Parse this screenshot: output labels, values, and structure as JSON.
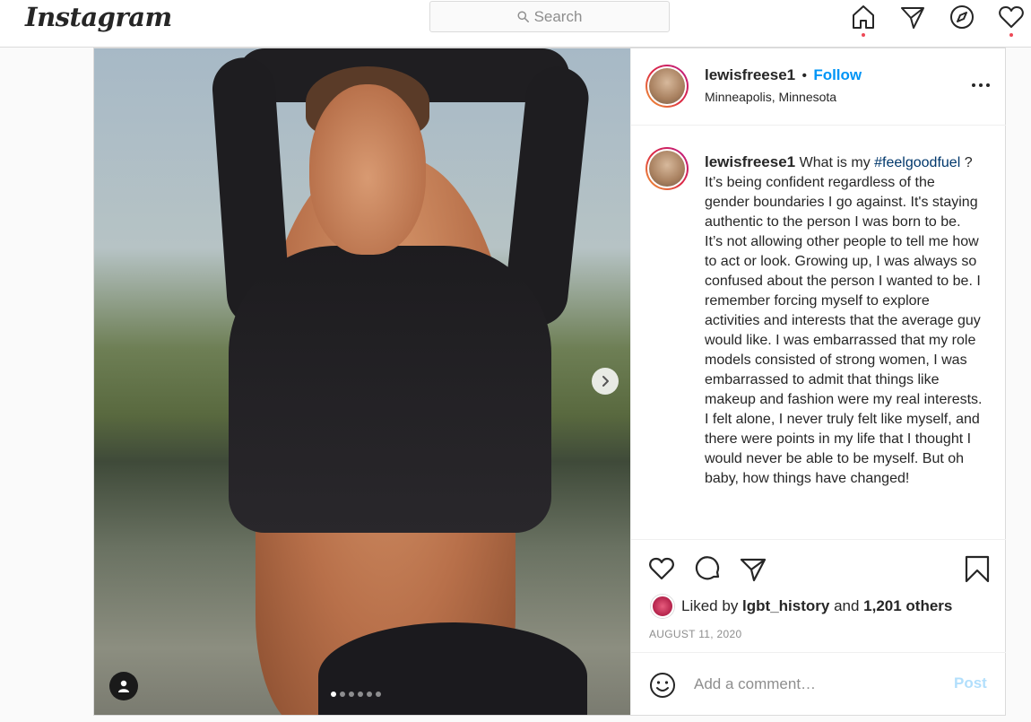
{
  "app": {
    "logo_text": "Instagram"
  },
  "search": {
    "placeholder": "Search"
  },
  "nav": {
    "icons": [
      "home-icon",
      "direct-icon",
      "explore-icon",
      "activity-icon"
    ]
  },
  "post": {
    "author": "lewisfreese1",
    "follow_label": "Follow",
    "separator": "•",
    "location": "Minneapolis, Minnesota",
    "more_label": "...",
    "caption": {
      "username": "lewisfreese1",
      "text_before_hashtag": " What is my ",
      "hashtag": "#feelgoodfuel",
      "text_after_hashtag": " ? It’s being confident regardless of the gender boundaries I go against. It's staying authentic to the person I was born to be. It’s not allowing other people to tell me how to act or look. Growing up, I was always so confused about the person I wanted to be. I remember forcing myself to explore activities and interests that the average guy would like. I was embarrassed that my role models consisted of strong women, I was embarrassed to admit that things like makeup and fashion were my real interests. I felt alone, I never truly felt like myself, and there were points in my life that I thought I would never be able to be myself. But oh baby, how things have changed!"
    },
    "carousel": {
      "count": 6,
      "active_index": 0
    },
    "likes": {
      "prefix": "Liked by ",
      "user": "lgbt_history",
      "middle": " and ",
      "count": "1,201 others"
    },
    "date": "AUGUST 11, 2020",
    "comment": {
      "placeholder": "Add a comment…",
      "post_label": "Post"
    }
  },
  "colors": {
    "link_blue": "#0095f6",
    "hashtag": "#00376b",
    "notification": "#ed4956",
    "post_disabled": "#b2dffc"
  }
}
